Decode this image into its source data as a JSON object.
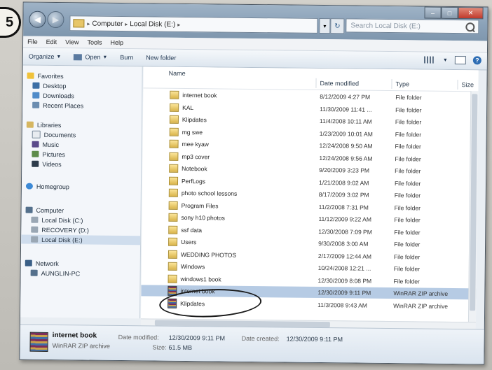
{
  "step": "5",
  "window": {
    "controls": [
      "–",
      "□",
      "✕"
    ]
  },
  "address": {
    "crumbs": [
      "Computer",
      "Local Disk (E:)"
    ],
    "search_placeholder": "Search Local Disk (E:)"
  },
  "menu": [
    "File",
    "Edit",
    "View",
    "Tools",
    "Help"
  ],
  "toolbar": {
    "organize": "Organize",
    "open": "Open",
    "burn": "Burn",
    "new_folder": "New folder"
  },
  "nav": {
    "favorites": "Favorites",
    "desktop": "Desktop",
    "downloads": "Downloads",
    "recent": "Recent Places",
    "libraries": "Libraries",
    "documents": "Documents",
    "music": "Music",
    "pictures": "Pictures",
    "videos": "Videos",
    "homegroup": "Homegroup",
    "computer": "Computer",
    "local_c": "Local Disk (C:)",
    "recovery": "RECOVERY (D:)",
    "local_e": "Local Disk (E:)",
    "network": "Network",
    "pc": "AUNGLIN-PC"
  },
  "columns": {
    "name": "Name",
    "date": "Date modified",
    "type": "Type",
    "size": "Size"
  },
  "files": [
    {
      "name": "internet book",
      "date": "8/12/2009 4:27 PM",
      "type": "File folder"
    },
    {
      "name": "KAL",
      "date": "11/30/2009 11:41 ...",
      "type": "File folder"
    },
    {
      "name": "Klipdates",
      "date": "11/4/2008 10:11 AM",
      "type": "File folder"
    },
    {
      "name": "mg swe",
      "date": "1/23/2009 10:01 AM",
      "type": "File folder"
    },
    {
      "name": "mee kyaw",
      "date": "12/24/2008 9:50 AM",
      "type": "File folder"
    },
    {
      "name": "mp3 cover",
      "date": "12/24/2008 9:56 AM",
      "type": "File folder"
    },
    {
      "name": "Notebook",
      "date": "9/20/2009 3:23 PM",
      "type": "File folder"
    },
    {
      "name": "PerfLogs",
      "date": "1/21/2008 9:02 AM",
      "type": "File folder"
    },
    {
      "name": "photo school lessons",
      "date": "8/17/2009 3:02 PM",
      "type": "File folder"
    },
    {
      "name": "Program Files",
      "date": "11/2/2008 7:31 PM",
      "type": "File folder"
    },
    {
      "name": "sony h10 photos",
      "date": "11/12/2009 9:22 AM",
      "type": "File folder"
    },
    {
      "name": "ssf data",
      "date": "12/30/2008 7:09 PM",
      "type": "File folder"
    },
    {
      "name": "Users",
      "date": "9/30/2008 3:00 AM",
      "type": "File folder"
    },
    {
      "name": "WEDDING PHOTOS",
      "date": "2/17/2009 12:44 AM",
      "type": "File folder"
    },
    {
      "name": "Windows",
      "date": "10/24/2008 12:21 ...",
      "type": "File folder"
    },
    {
      "name": "windows1 book",
      "date": "12/30/2009 8:08 PM",
      "type": "File folder"
    },
    {
      "name": "internet book",
      "date": "12/30/2009 9:11 PM",
      "type": "WinRAR ZIP archive",
      "selected": true
    },
    {
      "name": "Klipdates",
      "date": "11/3/2008 9:43 AM",
      "type": "WinRAR ZIP archive"
    }
  ],
  "details": {
    "name": "internet book",
    "type": "WinRAR ZIP archive",
    "modified_label": "Date modified:",
    "modified_value": "12/30/2009 9:11 PM",
    "size_label": "Size:",
    "size_value": "61.5 MB",
    "created_label": "Date created:",
    "created_value": "12/30/2009 9:11 PM"
  }
}
